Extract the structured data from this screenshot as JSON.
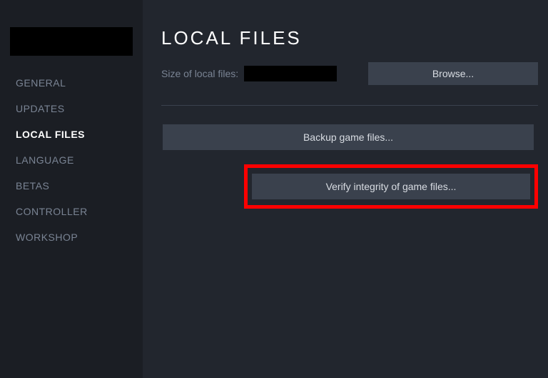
{
  "sidebar": {
    "items": [
      {
        "label": "GENERAL"
      },
      {
        "label": "UPDATES"
      },
      {
        "label": "LOCAL FILES"
      },
      {
        "label": "LANGUAGE"
      },
      {
        "label": "BETAS"
      },
      {
        "label": "CONTROLLER"
      },
      {
        "label": "WORKSHOP"
      }
    ]
  },
  "main": {
    "title": "LOCAL FILES",
    "size_label": "Size of local files:",
    "browse_label": "Browse...",
    "backup_label": "Backup game files...",
    "verify_label": "Verify integrity of game files..."
  }
}
